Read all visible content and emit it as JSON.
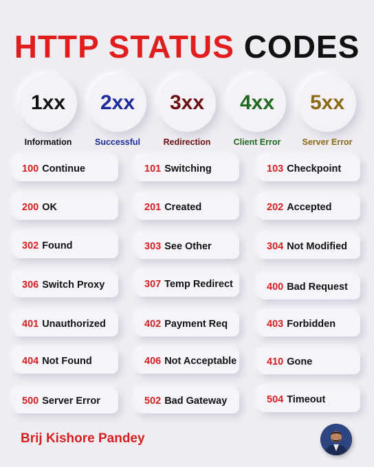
{
  "title": {
    "part1": "HTTP STATUS",
    "part2": "CODES"
  },
  "classes": [
    {
      "code": "1xx",
      "label": "Information",
      "code_color": "#111111",
      "label_color": "#111111"
    },
    {
      "code": "2xx",
      "label": "Successful",
      "code_color": "#1d2a9e",
      "label_color": "#1d2a9e"
    },
    {
      "code": "3xx",
      "label": "Redirection",
      "code_color": "#6a0f12",
      "label_color": "#6a0f12"
    },
    {
      "code": "4xx",
      "label": "Client Error",
      "code_color": "#1f6b1f",
      "label_color": "#1f6b1f"
    },
    {
      "code": "5xx",
      "label": "Server Error",
      "code_color": "#8b6a16",
      "label_color": "#8b6a16"
    }
  ],
  "codes": [
    {
      "code": "100",
      "text": "Continue"
    },
    {
      "code": "101",
      "text": "Switching"
    },
    {
      "code": "103",
      "text": "Checkpoint"
    },
    {
      "code": "200",
      "text": "OK"
    },
    {
      "code": "201",
      "text": "Created"
    },
    {
      "code": "202",
      "text": "Accepted"
    },
    {
      "code": "302",
      "text": "Found"
    },
    {
      "code": "303",
      "text": "See Other"
    },
    {
      "code": "304",
      "text": "Not Modified"
    },
    {
      "code": "306",
      "text": "Switch Proxy"
    },
    {
      "code": "307",
      "text": "Temp Redirect"
    },
    {
      "code": "400",
      "text": "Bad Request"
    },
    {
      "code": "401",
      "text": "Unauthorized"
    },
    {
      "code": "402",
      "text": "Payment Req"
    },
    {
      "code": "403",
      "text": "Forbidden"
    },
    {
      "code": "404",
      "text": "Not Found"
    },
    {
      "code": "406",
      "text": "Not Acceptable"
    },
    {
      "code": "410",
      "text": "Gone"
    },
    {
      "code": "500",
      "text": "Server Error"
    },
    {
      "code": "502",
      "text": "Bad Gateway"
    },
    {
      "code": "504",
      "text": "Timeout"
    }
  ],
  "author": "Brij Kishore Pandey",
  "colors": {
    "accent_red": "#d42020",
    "title_red": "#e01e1e",
    "background": "#efecf2"
  }
}
